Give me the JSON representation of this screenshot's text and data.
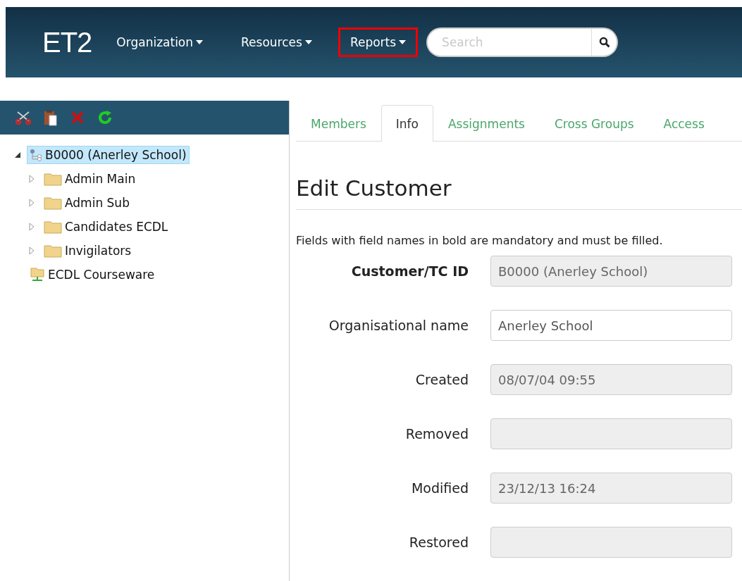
{
  "navbar": {
    "logo": "ET2",
    "menus": [
      {
        "label": "Organization",
        "highlighted": false
      },
      {
        "label": "Resources",
        "highlighted": false
      },
      {
        "label": "Reports",
        "highlighted": true
      }
    ],
    "search": {
      "placeholder": "Search"
    }
  },
  "toolbar": [
    {
      "kind": "cut"
    },
    {
      "kind": "paste"
    },
    {
      "kind": "delete"
    },
    {
      "kind": "refresh"
    }
  ],
  "tree": [
    {
      "label": "B0000 (Anerley School)",
      "kind": "org",
      "expanded": true,
      "selected": true,
      "children": [
        {
          "label": "Admin Main",
          "kind": "folder",
          "expanded": false,
          "selected": false
        },
        {
          "label": "Admin Sub",
          "kind": "folder",
          "expanded": false,
          "selected": false
        },
        {
          "label": "Candidates ECDL",
          "kind": "folder",
          "expanded": false,
          "selected": false
        },
        {
          "label": "Invigilators",
          "kind": "folder",
          "expanded": false,
          "selected": false
        }
      ]
    },
    {
      "label": "ECDL Courseware",
      "kind": "network",
      "selected": false
    }
  ],
  "tabs": [
    {
      "label": "Members",
      "selected": false
    },
    {
      "label": "Info",
      "selected": true
    },
    {
      "label": "Assignments",
      "selected": false
    },
    {
      "label": "Cross Groups",
      "selected": false
    },
    {
      "label": "Access",
      "selected": false
    }
  ],
  "heading": "Edit Customer",
  "note": "Fields with field names in bold are mandatory and must be filled.",
  "fields": [
    {
      "label": "Customer/TC ID",
      "value": "B0000 (Anerley School)",
      "mandatory": true,
      "disabled": true
    },
    {
      "label": "Organisational name",
      "value": "Anerley School",
      "mandatory": false,
      "disabled": false
    },
    {
      "label": "Created",
      "value": "08/07/04 09:55",
      "mandatory": false,
      "disabled": true
    },
    {
      "label": "Removed",
      "mandatory": false,
      "disabled": true
    },
    {
      "label": "Modified",
      "value": "23/12/13 16:24",
      "mandatory": false,
      "disabled": true
    },
    {
      "label": "Restored",
      "mandatory": false,
      "disabled": true
    }
  ]
}
